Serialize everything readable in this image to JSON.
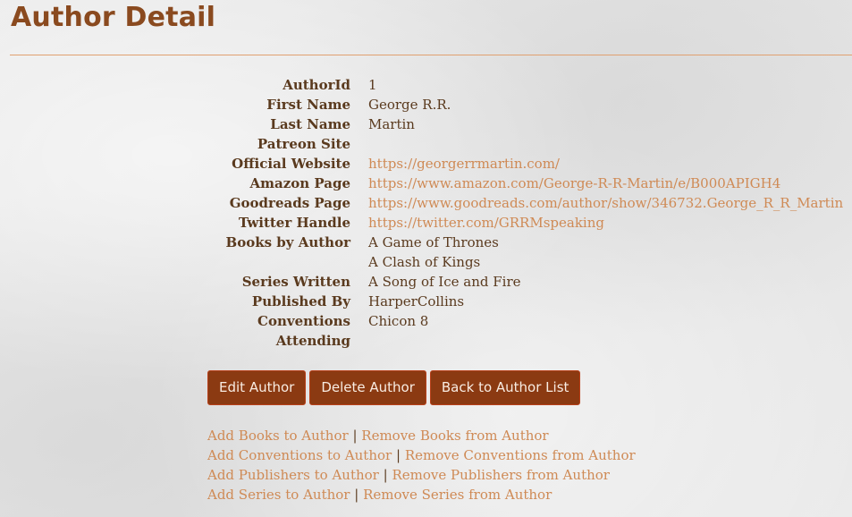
{
  "page": {
    "title": "Author Detail"
  },
  "fields": [
    {
      "label": "AuthorId",
      "values": [
        "1"
      ],
      "is_link": false
    },
    {
      "label": "First Name",
      "values": [
        "George R.R."
      ],
      "is_link": false
    },
    {
      "label": "Last Name",
      "values": [
        "Martin"
      ],
      "is_link": false
    },
    {
      "label": "Patreon Site",
      "values": [
        ""
      ],
      "is_link": false
    },
    {
      "label": "Official Website",
      "values": [
        "https://georgerrmartin.com/"
      ],
      "is_link": true
    },
    {
      "label": "Amazon Page",
      "values": [
        "https://www.amazon.com/George-R-R-Martin/e/B000APIGH4"
      ],
      "is_link": true
    },
    {
      "label": "Goodreads Page",
      "values": [
        "https://www.goodreads.com/author/show/346732.George_R_R_Martin"
      ],
      "is_link": true
    },
    {
      "label": "Twitter Handle",
      "values": [
        "https://twitter.com/GRRMspeaking"
      ],
      "is_link": true
    },
    {
      "label": "Books by Author",
      "values": [
        "A Game of Thrones",
        "A Clash of Kings"
      ],
      "is_link": false
    },
    {
      "label": "Series Written",
      "values": [
        "A Song of Ice and Fire"
      ],
      "is_link": false
    },
    {
      "label": "Published By",
      "values": [
        "HarperCollins"
      ],
      "is_link": false
    },
    {
      "label": "Conventions",
      "values": [
        "Chicon 8"
      ],
      "is_link": false
    },
    {
      "label": "Attending",
      "values": [
        ""
      ],
      "is_link": false
    }
  ],
  "buttons": {
    "edit": "Edit Author",
    "delete": "Delete Author",
    "back": "Back to Author List"
  },
  "link_rows": [
    {
      "add": "Add Books to Author",
      "remove": "Remove Books from Author"
    },
    {
      "add": "Add Conventions to Author",
      "remove": "Remove Conventions from Author"
    },
    {
      "add": "Add Publishers to Author",
      "remove": "Remove Publishers from Author"
    },
    {
      "add": "Add Series to Author",
      "remove": "Remove Series from Author"
    }
  ],
  "separator": "|",
  "colors": {
    "title": "#8a4a1f",
    "label": "#5a3a1e",
    "link": "#cf8a55",
    "button_bg": "#8b3a12",
    "button_text": "#f8ece2"
  }
}
